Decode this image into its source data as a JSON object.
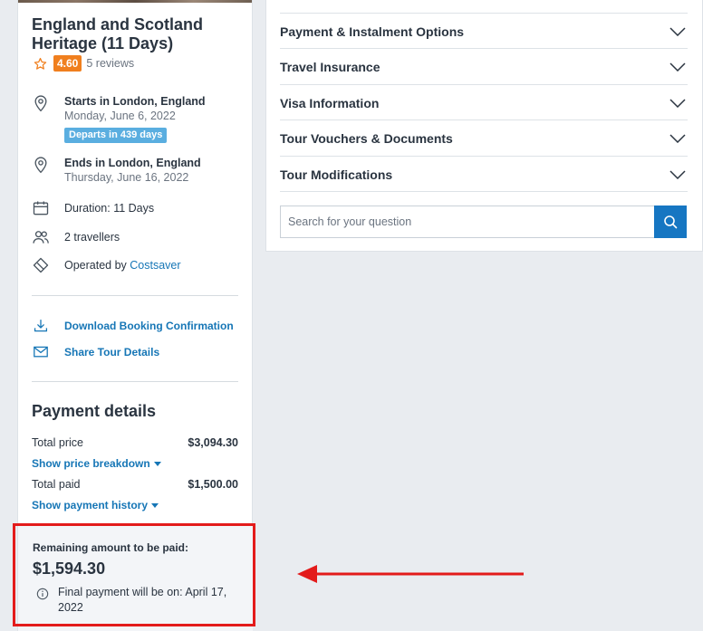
{
  "tour": {
    "title": "England and Scotland Heritage (11 Days)",
    "rating": "4.60",
    "reviews": "5 reviews"
  },
  "itinerary": {
    "start_label": "Starts in London, England",
    "start_date": "Monday, June 6, 2022",
    "departs_badge": "Departs in 439 days",
    "end_label": "Ends in London, England",
    "end_date": "Thursday, June 16, 2022",
    "duration": "Duration: 11 Days",
    "travellers": "2 travellers",
    "operated_prefix": "Operated by ",
    "operator": "Costsaver"
  },
  "actions": {
    "download": "Download Booking Confirmation",
    "share": "Share Tour Details"
  },
  "payment": {
    "heading": "Payment details",
    "total_price_label": "Total price",
    "total_price": "$3,094.30",
    "show_breakdown": "Show price breakdown",
    "total_paid_label": "Total paid",
    "total_paid": "$1,500.00",
    "show_history": "Show payment history",
    "remaining_label": "Remaining amount to be paid:",
    "remaining_amount": "$1,594.30",
    "final_payment_note": "Final payment will be on: April 17, 2022"
  },
  "faq": {
    "items": [
      {
        "label": "Payment & Instalment Options"
      },
      {
        "label": "Travel Insurance"
      },
      {
        "label": "Visa Information"
      },
      {
        "label": "Tour Vouchers & Documents"
      },
      {
        "label": "Tour Modifications"
      }
    ],
    "search_placeholder": "Search for your question"
  },
  "colors": {
    "accent": "#1676b6",
    "rating_badge": "#f07f1e",
    "departs_badge": "#5aaee0",
    "highlight": "#e31b1b"
  },
  "icons": [
    "star-icon",
    "location-pin-icon",
    "calendar-icon",
    "people-icon",
    "tag-icon",
    "download-icon",
    "envelope-icon",
    "info-icon",
    "chevron-down-icon",
    "search-icon",
    "arrow-left-icon"
  ]
}
